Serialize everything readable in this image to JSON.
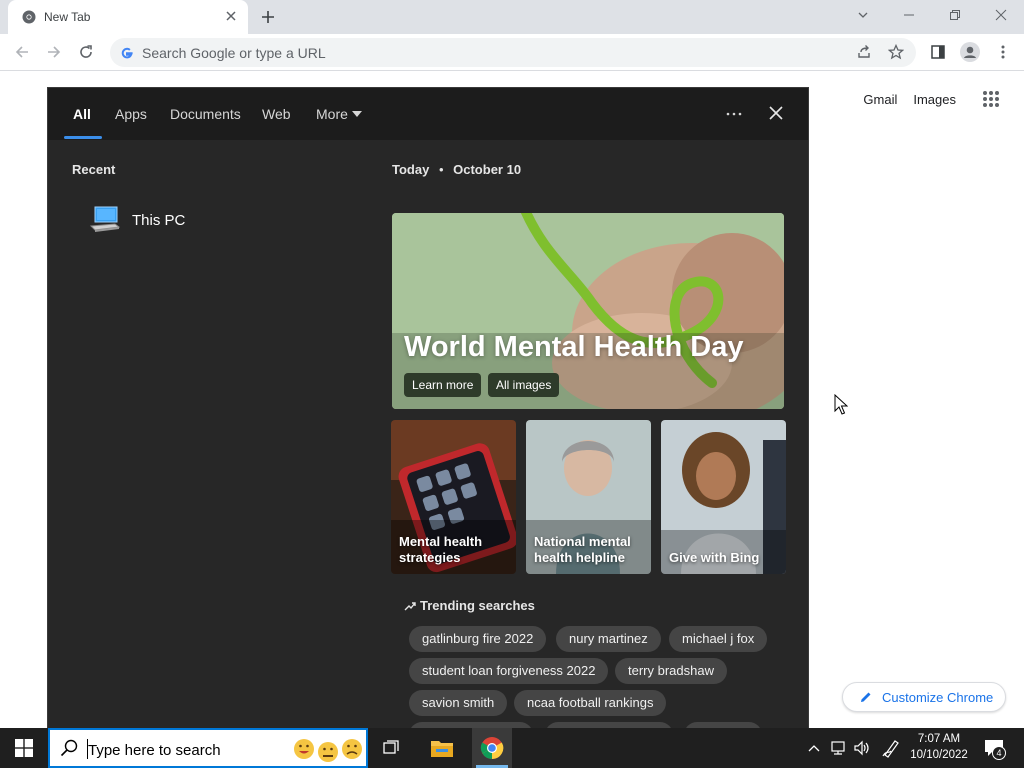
{
  "browser": {
    "tab_title": "New Tab",
    "omnibox_placeholder": "Search Google or type a URL"
  },
  "ntp": {
    "gmail": "Gmail",
    "images": "Images",
    "customize": "Customize Chrome"
  },
  "search_panel": {
    "tabs": [
      {
        "label": "All",
        "active": true
      },
      {
        "label": "Apps"
      },
      {
        "label": "Documents"
      },
      {
        "label": "Web"
      },
      {
        "label": "More"
      }
    ],
    "recent_label": "Recent",
    "recent_items": [
      {
        "label": "This PC",
        "icon": "computer-icon"
      }
    ],
    "date_prefix": "Today",
    "date": "October 10",
    "hero": {
      "title": "World Mental Health Day",
      "buttons": [
        "Learn more",
        "All images"
      ]
    },
    "cards": [
      {
        "label": "Mental health strategies"
      },
      {
        "label": "National mental health helpline"
      },
      {
        "label": "Give with Bing"
      }
    ],
    "trending_label": "Trending searches",
    "trending": [
      "gatlinburg fire 2022",
      "nury martinez",
      "michael j fox",
      "student loan forgiveness 2022",
      "terry bradshaw",
      "savion smith",
      "ncaa football rankings"
    ]
  },
  "taskbar": {
    "search_placeholder": "Type here to search",
    "time": "7:07 AM",
    "date": "10/10/2022",
    "notification_count": "4"
  },
  "colors": {
    "accent": "#3b8eea",
    "panel_bg": "#272727",
    "taskbar_bg": "#1f1f1f",
    "chrome_blue": "#1a73e8"
  }
}
